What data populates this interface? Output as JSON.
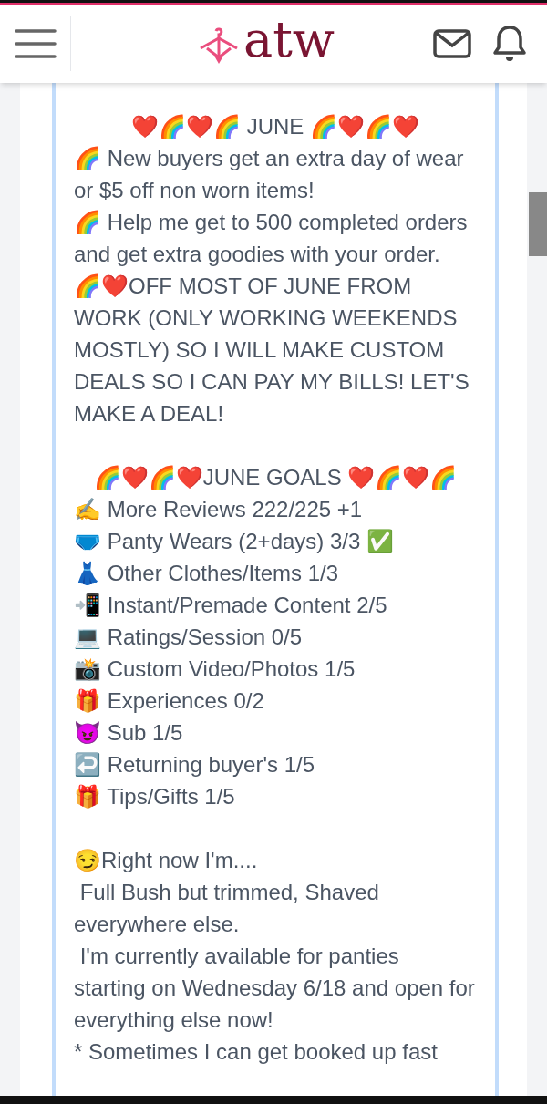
{
  "header": {
    "logo": "atw"
  },
  "post": {
    "sections": [
      {
        "lines": [
          {
            "text": "❤️🌈❤️🌈 JUNE 🌈❤️🌈❤️",
            "centered": true
          },
          {
            "text": "🌈 New buyers get an extra day of wear or $5 off non worn items!",
            "centered": false
          },
          {
            "text": "🌈 Help me get to 500 completed orders and get extra goodies with your order.",
            "centered": false
          },
          {
            "text": "🌈❤️OFF MOST OF JUNE FROM WORK (ONLY WORKING WEEKENDS MOSTLY) SO I WILL MAKE CUSTOM DEALS SO I CAN PAY MY BILLS! LET'S MAKE A DEAL!",
            "centered": false
          }
        ]
      },
      {
        "lines": [
          {
            "text": "🌈❤️🌈❤️JUNE GOALS ❤️🌈❤️🌈",
            "centered": true
          },
          {
            "text": "✍️ More Reviews 222/225 +1",
            "centered": false
          },
          {
            "text": "🩲 Panty Wears (2+days) 3/3 ✅",
            "centered": false
          },
          {
            "text": "👗 Other Clothes/Items 1/3",
            "centered": false
          },
          {
            "text": "📲 Instant/Premade Content 2/5",
            "centered": false
          },
          {
            "text": "💻 Ratings/Session 0/5",
            "centered": false
          },
          {
            "text": "📸 Custom Video/Photos 1/5",
            "centered": false
          },
          {
            "text": "🎁 Experiences 0/2",
            "centered": false
          },
          {
            "text": "😈 Sub 1/5",
            "centered": false
          },
          {
            "text": "↩️ Returning buyer's 1/5",
            "centered": false
          },
          {
            "text": "🎁 Tips/Gifts 1/5",
            "centered": false
          }
        ]
      },
      {
        "lines": [
          {
            "text": "😏Right now I'm....",
            "centered": false
          },
          {
            "text": " Full Bush but trimmed, Shaved everywhere else.",
            "centered": false
          },
          {
            "text": " I'm currently available for panties starting on Wednesday 6/18 and open for everything else now!",
            "centered": false
          },
          {
            "text": "* Sometimes I can get booked up fast",
            "centered": false
          }
        ]
      }
    ]
  }
}
